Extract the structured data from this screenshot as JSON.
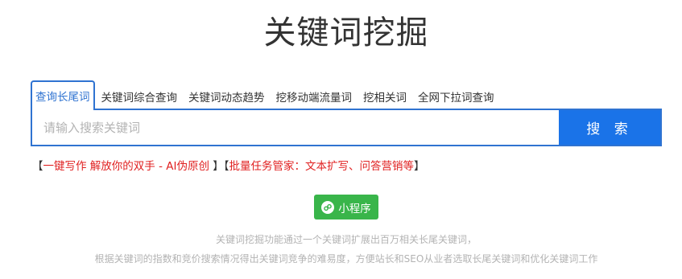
{
  "header": {
    "title": "关键词挖掘"
  },
  "tabs": [
    {
      "label": "查询长尾词",
      "active": true
    },
    {
      "label": "关键词综合查询",
      "active": false
    },
    {
      "label": "关键词动态趋势",
      "active": false
    },
    {
      "label": "挖移动端流量词",
      "active": false
    },
    {
      "label": "挖相关词",
      "active": false
    },
    {
      "label": "全网下拉词查询",
      "active": false
    }
  ],
  "search": {
    "value": "",
    "placeholder": "请输入搜索关键词",
    "button_label": "搜 索"
  },
  "promos": {
    "open_bracket_1": "【",
    "link_1": "一键写作 解放你的双手 - AI伪原创",
    "close_bracket_1": " 】",
    "open_bracket_2": "【",
    "link_2": "批量任务管家：文本扩写、问答营销等",
    "close_bracket_2": "】"
  },
  "mini_program": {
    "label": "小程序",
    "icon": "mini-program-icon"
  },
  "description": {
    "line1": "关键词挖掘功能通过一个关键词扩展出百万相关长尾关键词，",
    "line2": "根据关键词的指数和竞价搜索情况得出关键词竞争的难易度，方便站长和SEO从业者选取长尾关键词和优化关键词工作"
  },
  "colors": {
    "accent": "#2f73d1",
    "button": "#1a73e8",
    "promo": "#e02020",
    "mini_program": "#39b54a",
    "muted": "#b3b3b3"
  }
}
